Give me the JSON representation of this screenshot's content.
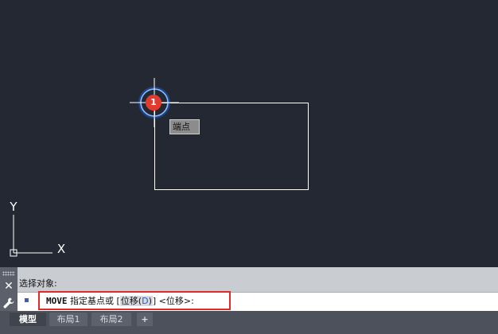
{
  "viewport": {
    "tooltip": "端点",
    "marker_number": "1",
    "ucs": {
      "x_label": "X",
      "y_label": "Y"
    }
  },
  "command": {
    "history_line": "选择对象:",
    "prompt_icon": "▪",
    "close_label": "✕",
    "command_name": "MOVE",
    "prompt_text": "指定基点或",
    "bracket_open": "[",
    "option_label": "位移",
    "option_key_open": "(",
    "option_key": "D",
    "option_key_close": ")",
    "bracket_close": "]",
    "default_option": "<位移>:"
  },
  "tabs": {
    "items": [
      "模型",
      "布局1",
      "布局2"
    ],
    "add_label": "+"
  },
  "colors": {
    "canvas_bg": "#232833",
    "highlight_border": "#e12b2b",
    "marker_red": "#e23a2e",
    "snap_circle": "#4a90e2"
  }
}
